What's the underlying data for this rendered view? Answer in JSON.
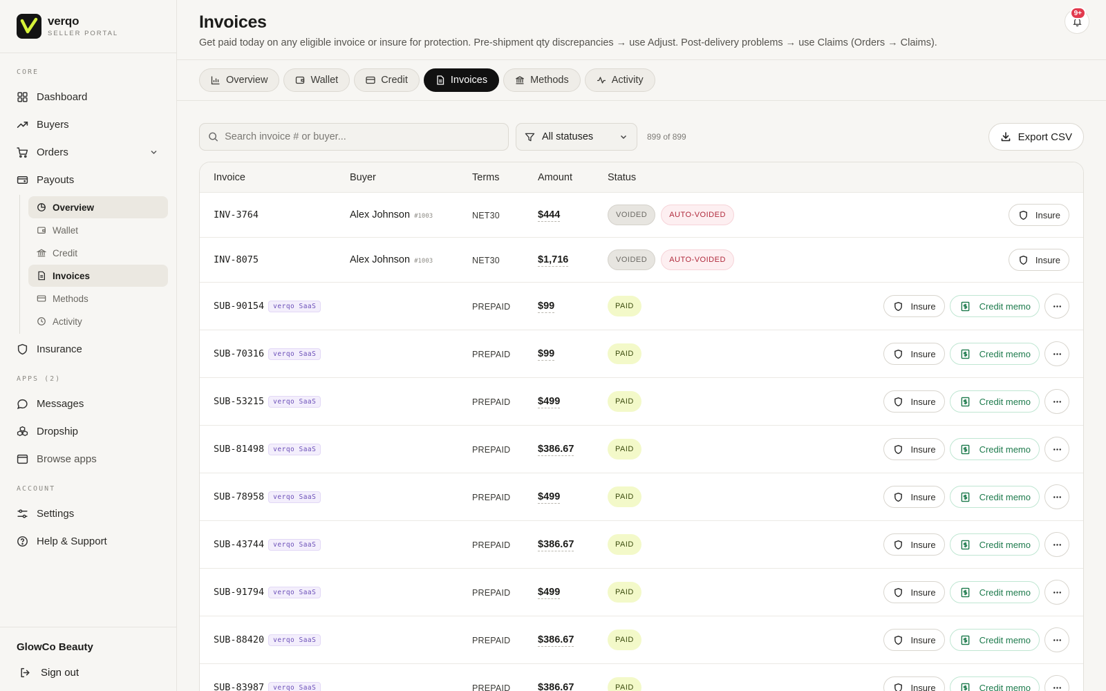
{
  "brand": {
    "name": "verqo",
    "subtitle": "SELLER PORTAL"
  },
  "sidebar": {
    "core_label": "CORE",
    "items": [
      {
        "label": "Dashboard",
        "icon": "grid-icon"
      },
      {
        "label": "Buyers",
        "icon": "trend-icon"
      },
      {
        "label": "Orders",
        "icon": "cart-icon"
      },
      {
        "label": "Payouts",
        "icon": "wallet-icon"
      }
    ],
    "payouts_sub": [
      {
        "label": "Overview",
        "icon": "pie-icon"
      },
      {
        "label": "Wallet",
        "icon": "wallet-icon"
      },
      {
        "label": "Credit",
        "icon": "bank-icon"
      },
      {
        "label": "Invoices",
        "icon": "document-icon"
      },
      {
        "label": "Methods",
        "icon": "card-icon"
      },
      {
        "label": "Activity",
        "icon": "clock-icon"
      }
    ],
    "insurance": "Insurance",
    "apps_label": "APPS (2)",
    "apps": [
      {
        "label": "Messages",
        "icon": "chat-icon"
      },
      {
        "label": "Dropship",
        "icon": "boxes-icon"
      },
      {
        "label": "Browse apps",
        "icon": "browser-icon"
      }
    ],
    "account_label": "ACCOUNT",
    "account": [
      {
        "label": "Settings",
        "icon": "sliders-icon"
      },
      {
        "label": "Help & Support",
        "icon": "help-icon"
      }
    ],
    "org": "GlowCo Beauty",
    "signout": "Sign out"
  },
  "header": {
    "title": "Invoices",
    "subtitle": "Get paid today on any eligible invoice or insure for protection. Pre-shipment qty discrepancies → use Adjust. Post-delivery problems → use Claims (Orders → Claims).",
    "notif_count": "9+"
  },
  "tabs": [
    "Overview",
    "Wallet",
    "Credit",
    "Invoices",
    "Methods",
    "Activity"
  ],
  "toolbar": {
    "search_placeholder": "Search invoice # or buyer...",
    "filter": "All statuses",
    "count": "899 of 899",
    "export": "Export CSV"
  },
  "table": {
    "headers": [
      "Invoice",
      "Buyer",
      "Terms",
      "Amount",
      "Status"
    ],
    "insure_label": "Insure",
    "credit_memo_label": "Credit memo",
    "saas_tag": "verqo SaaS",
    "rows": [
      {
        "id": "INV-3764",
        "buyer": "Alex Johnson",
        "buyer_num": "#1003",
        "terms": "NET30",
        "amount": "$444",
        "status": [
          "VOIDED",
          "AUTO-VOIDED"
        ]
      },
      {
        "id": "INV-8075",
        "buyer": "Alex Johnson",
        "buyer_num": "#1003",
        "terms": "NET30",
        "amount": "$1,716",
        "status": [
          "VOIDED",
          "AUTO-VOIDED"
        ]
      },
      {
        "id": "SUB-90154",
        "terms": "PREPAID",
        "amount": "$99",
        "status": [
          "PAID"
        ]
      },
      {
        "id": "SUB-70316",
        "terms": "PREPAID",
        "amount": "$99",
        "status": [
          "PAID"
        ]
      },
      {
        "id": "SUB-53215",
        "terms": "PREPAID",
        "amount": "$499",
        "status": [
          "PAID"
        ]
      },
      {
        "id": "SUB-81498",
        "terms": "PREPAID",
        "amount": "$386.67",
        "status": [
          "PAID"
        ]
      },
      {
        "id": "SUB-78958",
        "terms": "PREPAID",
        "amount": "$499",
        "status": [
          "PAID"
        ]
      },
      {
        "id": "SUB-43744",
        "terms": "PREPAID",
        "amount": "$386.67",
        "status": [
          "PAID"
        ]
      },
      {
        "id": "SUB-91794",
        "terms": "PREPAID",
        "amount": "$499",
        "status": [
          "PAID"
        ]
      },
      {
        "id": "SUB-88420",
        "terms": "PREPAID",
        "amount": "$386.67",
        "status": [
          "PAID"
        ]
      },
      {
        "id": "SUB-83987",
        "terms": "PREPAID",
        "amount": "$386.67",
        "status": [
          "PAID"
        ]
      }
    ]
  }
}
